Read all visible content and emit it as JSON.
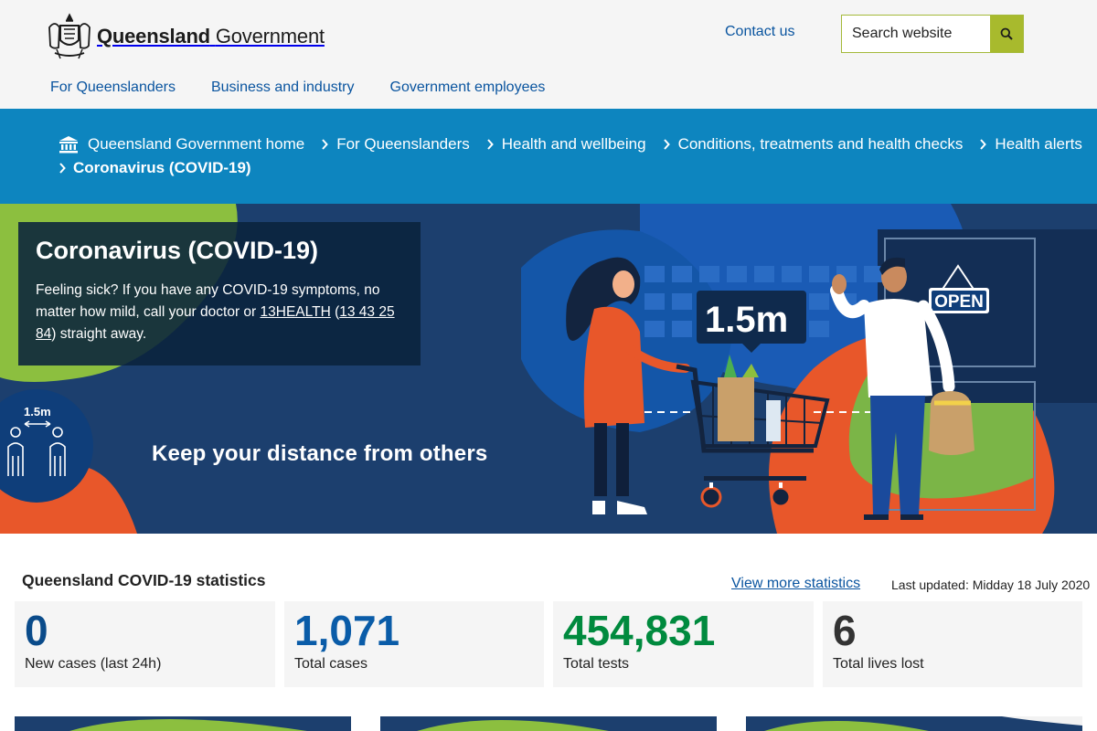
{
  "header": {
    "logo_bold": "Queensland",
    "logo_light": "Government",
    "contact_label": "Contact us",
    "search_placeholder": "Search website",
    "nav": [
      "For Queenslanders",
      "Business and industry",
      "Government employees"
    ]
  },
  "breadcrumb": {
    "items": [
      "Queensland Government home",
      "For Queenslanders",
      "Health and wellbeing",
      "Conditions, treatments and health checks",
      "Health alerts"
    ],
    "current": "Coronavirus (COVID-19)"
  },
  "hero": {
    "title": "Coronavirus (COVID-19)",
    "text_before": "Feeling sick? If you have any COVID-19 symptoms, no matter how mild, call your doctor or ",
    "link_health": "13HEALTH",
    "link_phone": "13 43 25 84",
    "text_after": ") straight away.",
    "distance_small_label": "1.5m",
    "distance_big_label": "1.5m",
    "open_sign": "OPEN",
    "tagline": "Keep your distance from others"
  },
  "stats": {
    "title": "Queensland COVID-19 statistics",
    "more_link": "View more statistics",
    "updated": "Last updated: Midday 18 July 2020",
    "cards": [
      {
        "value": "0",
        "label": "New cases (last 24h)",
        "color": "#0a4b8a"
      },
      {
        "value": "1,071",
        "label": "Total cases",
        "color": "#0a5ca8"
      },
      {
        "value": "454,831",
        "label": "Total tests",
        "color": "#008a3e"
      },
      {
        "value": "6",
        "label": "Total lives lost",
        "color": "#333333"
      }
    ]
  },
  "colors": {
    "nav_link": "#09549f",
    "breadcrumb_bg": "#0d85bf",
    "hero_bg": "#1c3f6e",
    "accent_green": "#a8ba2d",
    "accent_orange": "#e8572a"
  }
}
